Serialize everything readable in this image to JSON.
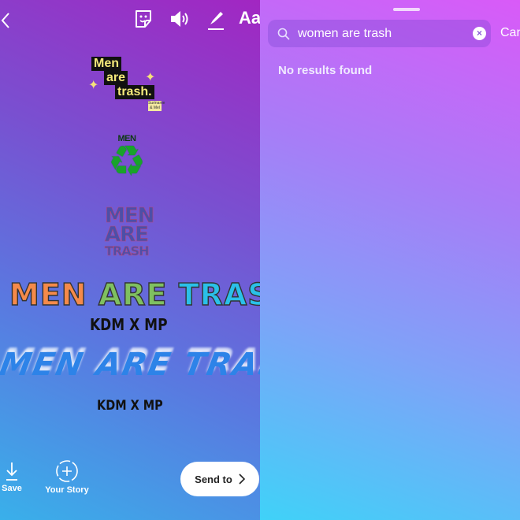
{
  "story_editor": {
    "toolbar": {
      "back_icon": "chevron-left-icon",
      "sticker_icon": "sticker-icon",
      "sound_icon": "speaker-icon",
      "draw_icon": "pen-icon",
      "text_label": "Aa"
    },
    "stickers": [
      {
        "lines": [
          "Men",
          "are",
          "trash."
        ],
        "stamp": "Suriname & Mel"
      },
      {
        "top": "MEN",
        "small": "KDM X MP"
      },
      {
        "lines": [
          "MEN",
          "ARE",
          "TRASH"
        ]
      },
      {
        "words": [
          "MEN",
          "ARE",
          "TRASH",
          "!"
        ],
        "colors": [
          "#f58a4a",
          "#7fc060",
          "#2ac0e8",
          "#111111"
        ],
        "credit": "KDM X MP"
      },
      {
        "text": "MEN ARE TRASH",
        "credit": "KDM X MP"
      }
    ],
    "bottom": {
      "save_label": "Save",
      "your_story_label": "Your Story",
      "send_to_label": "Send to"
    }
  },
  "sticker_search": {
    "query": "women are trash",
    "cancel_label": "Cancel",
    "empty_message": "No results found"
  }
}
